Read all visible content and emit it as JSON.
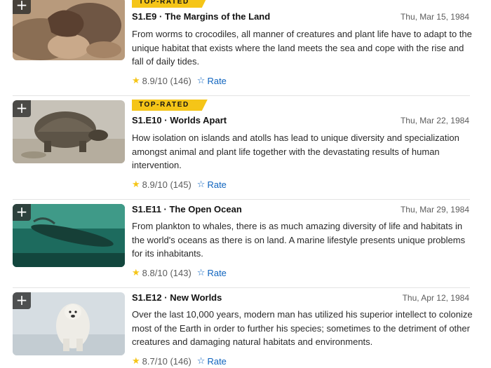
{
  "episodes": [
    {
      "badge": "TOP-RATED",
      "title": "S1.E9 · The Margins of the Land",
      "date": "Thu, Mar 15, 1984",
      "description": "From worms to crocodiles, all manner of creatures and plant life have to adapt to the unique habitat that exists where the land meets the sea and cope with the rise and fall of daily tides.",
      "rating": "8.9/10",
      "votes": "(146)",
      "rate_label": "Rate"
    },
    {
      "badge": "TOP-RATED",
      "title": "S1.E10 · Worlds Apart",
      "date": "Thu, Mar 22, 1984",
      "description": "How isolation on islands and atolls has lead to unique diversity and specialization amongst animal and plant life together with the devastating results of human intervention.",
      "rating": "8.9/10",
      "votes": "(145)",
      "rate_label": "Rate"
    },
    {
      "title": "S1.E11 · The Open Ocean",
      "date": "Thu, Mar 29, 1984",
      "description": "From plankton to whales, there is as much amazing diversity of life and habitats in the world's oceans as there is on land. A marine lifestyle presents unique problems for its inhabitants.",
      "rating": "8.8/10",
      "votes": "(143)",
      "rate_label": "Rate"
    },
    {
      "title": "S1.E12 · New Worlds",
      "date": "Thu, Apr 12, 1984",
      "description": "Over the last 10,000 years, modern man has utilized his superior intellect to colonize most of the Earth in order to further his species; sometimes to the detriment of other creatures and damaging natural habitats and environments.",
      "rating": "8.7/10",
      "votes": "(146)",
      "rate_label": "Rate"
    }
  ],
  "icons": {
    "add": "+",
    "star_filled": "★",
    "star_outline": "☆"
  },
  "colors": {
    "badge": "#f5c518",
    "star": "#f5c518",
    "link": "#0e63be"
  }
}
